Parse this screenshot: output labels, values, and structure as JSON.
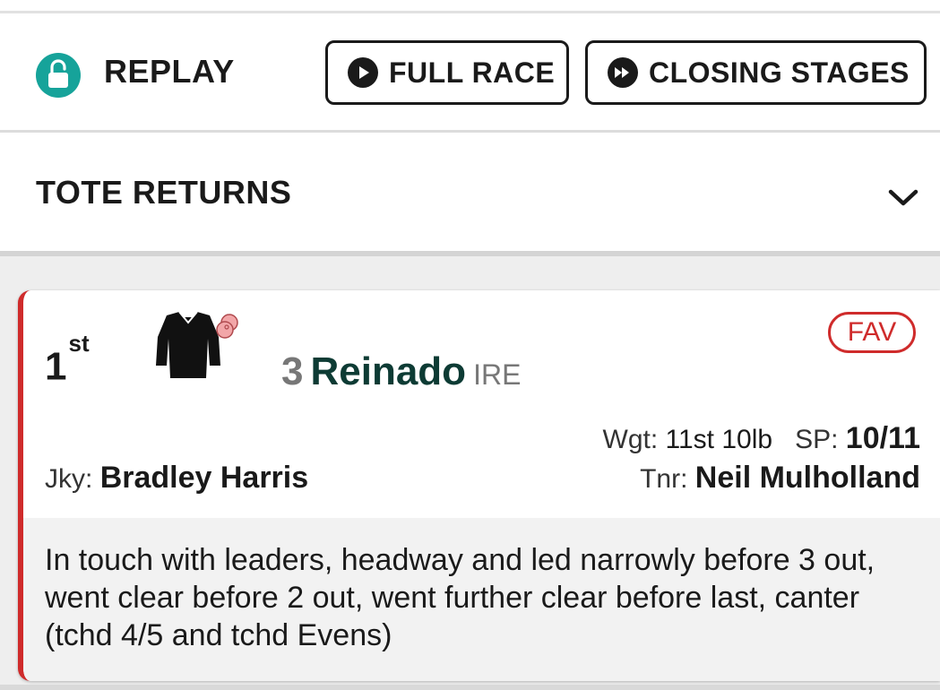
{
  "replay": {
    "label": "REPLAY",
    "lock_icon": "lock-open-icon",
    "lock_color": "#16a39a",
    "buttons": [
      {
        "label": "FULL RACE",
        "icon": "play-circle-icon"
      },
      {
        "label": "CLOSING STAGES",
        "icon": "fast-forward-circle-icon"
      }
    ]
  },
  "tote": {
    "label": "TOTE RETURNS",
    "expand_icon": "chevron-down-icon"
  },
  "result": {
    "position": "1",
    "position_suffix": "st",
    "silks_icon": "jockey-silks-icon",
    "cap_icon": "cap-icon",
    "number": "3",
    "horse_name": "Reinado",
    "country": "IRE",
    "badge": "FAV",
    "weight_label": "Wgt:",
    "weight": "11st 10lb",
    "sp_label": "SP:",
    "sp": "10/11",
    "jockey_label": "Jky:",
    "jockey": "Bradley Harris",
    "trainer_label": "Tnr:",
    "trainer": "Neil Mulholland",
    "comment": "In touch with leaders, headway and led narrowly before 3 out, went clear before 2 out, went further clear before last, canter (tchd 4/5 and tchd Evens)",
    "accent_color": "#cf2b2b"
  }
}
